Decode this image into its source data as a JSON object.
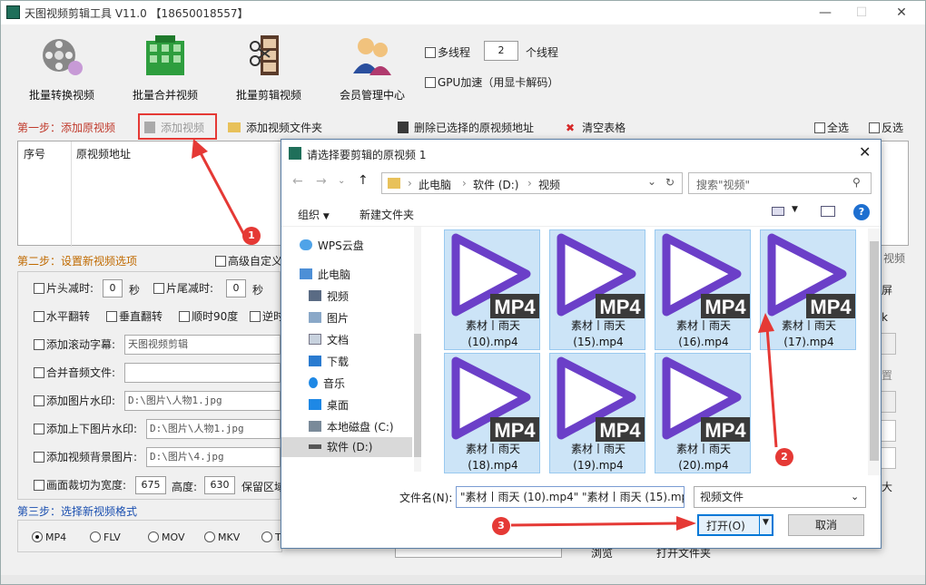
{
  "window": {
    "title": "天图视频剪辑工具 V11.0 【18650018557】"
  },
  "toolbar": [
    {
      "label": "批量转换视频"
    },
    {
      "label": "批量合并视频"
    },
    {
      "label": "批量剪辑视频"
    },
    {
      "label": "会员管理中心"
    }
  ],
  "options": {
    "multithread_label": "多线程",
    "thread_count": "2",
    "thread_unit": "个线程",
    "gpu_label": "GPU加速（用显卡解码）"
  },
  "step1": {
    "label": "第一步：添加原视频",
    "add_video": "添加视频",
    "add_folder": "添加视频文件夹",
    "delete_selected": "删除已选择的原视频地址",
    "clear_table": "清空表格",
    "select_all": "全选",
    "invert": "反选",
    "col_index": "序号",
    "col_path": "原视频地址"
  },
  "step2": {
    "label": "第二步：设置新视频选项",
    "advanced": "高级自定义",
    "head_cut": "片头减时:",
    "head_val": "0",
    "sec": "秒",
    "tail_cut": "片尾减时:",
    "tail_val": "0",
    "sec2": "秒",
    "hflip": "水平翻转",
    "vflip": "垂直翻转",
    "rotate": "顺时90度",
    "rotate_ccw": "逆时",
    "scroll_sub": "添加滚动字幕:",
    "scroll_val": "天图视频剪辑",
    "merge_audio": "合并音频文件:",
    "img_watermark": "添加图片水印:",
    "img_watermark_val": "D:\\图片\\人物1.jpg",
    "tb_img": "添加上下图片水印:",
    "tb_img_val": "D:\\图片\\人物1.jpg",
    "bg_img": "添加视频背景图片:",
    "bg_img_val": "D:\\图片\\4.jpg",
    "crop": "画面裁切为宽度:",
    "crop_w": "675",
    "crop_h_label": "高度:",
    "crop_h": "630",
    "keep_area": "保留区域"
  },
  "step3": {
    "label": "第三步：选择新视频格式",
    "formats": [
      "MP4",
      "FLV",
      "MOV",
      "MKV",
      "T"
    ]
  },
  "right_fragments": {
    "video": "视频",
    "screen": "屏",
    "k": "k",
    "pos": "置",
    "big": "大"
  },
  "bottom_fragments": {
    "browse": "浏览",
    "open_folder": "打开文件夹"
  },
  "dialog": {
    "title": "请选择要剪辑的原视频 1",
    "breadcrumb": [
      "此电脑",
      "软件 (D:)",
      "视频"
    ],
    "search_placeholder": "搜索\"视频\"",
    "organize": "组织",
    "new_folder": "新建文件夹",
    "nav": [
      {
        "label": "WPS云盘",
        "icon": "cloud-icon"
      },
      {
        "label": "此电脑",
        "icon": "computer-icon"
      },
      {
        "label": "视频",
        "icon": "video-folder-icon"
      },
      {
        "label": "图片",
        "icon": "picture-folder-icon"
      },
      {
        "label": "文档",
        "icon": "document-folder-icon"
      },
      {
        "label": "下载",
        "icon": "download-folder-icon"
      },
      {
        "label": "音乐",
        "icon": "music-folder-icon"
      },
      {
        "label": "桌面",
        "icon": "desktop-folder-icon"
      },
      {
        "label": "本地磁盘 (C:)",
        "icon": "drive-icon"
      },
      {
        "label": "软件 (D:)",
        "icon": "drive-icon"
      }
    ],
    "files": [
      {
        "line1": "素材丨雨天",
        "line2": "(10).mp4",
        "selected": true
      },
      {
        "line1": "素材丨雨天",
        "line2": "(15).mp4",
        "selected": true
      },
      {
        "line1": "素材丨雨天",
        "line2": "(16).mp4",
        "selected": true
      },
      {
        "line1": "素材丨雨天",
        "line2": "(17).mp4",
        "selected": true
      },
      {
        "line1": "素材丨雨天",
        "line2": "(18).mp4",
        "selected": true
      },
      {
        "line1": "素材丨雨天",
        "line2": "(19).mp4",
        "selected": true
      },
      {
        "line1": "素材丨雨天",
        "line2": "(20).mp4",
        "selected": true
      }
    ],
    "badge": "MP4",
    "filename_label": "文件名(N):",
    "filename_value": "\"素材丨雨天 (10).mp4\" \"素材丨雨天 (15).mp4\" \"素材丨雨天 (16).n",
    "filetype": "视频文件",
    "open": "打开(O)",
    "cancel": "取消"
  },
  "annotations": [
    "1",
    "2",
    "3"
  ],
  "colors": {
    "accent_red": "#e53935",
    "step_red": "#c0392b",
    "step_blue": "#1a4fb0",
    "select_bg": "#cce4f7",
    "play_purple": "#6b3fc8"
  }
}
